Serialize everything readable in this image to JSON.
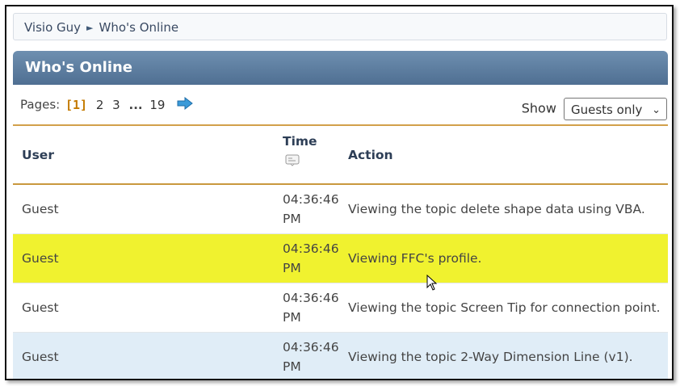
{
  "breadcrumb": {
    "items": [
      "Visio Guy",
      "Who's Online"
    ],
    "separator": "►"
  },
  "header": {
    "title": "Who's Online"
  },
  "pagination": {
    "label": "Pages:",
    "current": "[1]",
    "pages": [
      "2",
      "3"
    ],
    "ellipsis": "...",
    "last": "19"
  },
  "filter": {
    "label": "Show",
    "selected": "Guests only",
    "chevron": "⌄"
  },
  "table": {
    "columns": {
      "user": "User",
      "time": "Time",
      "action": "Action"
    },
    "rows": [
      {
        "user": "Guest",
        "time_line1": "04:36:46",
        "time_line2": "PM",
        "action": "Viewing the topic delete shape data using VBA."
      },
      {
        "user": "Guest",
        "time_line1": "04:36:46",
        "time_line2": "PM",
        "action": "Viewing FFC's profile."
      },
      {
        "user": "Guest",
        "time_line1": "04:36:46",
        "time_line2": "PM",
        "action": "Viewing the topic Screen Tip for connection point."
      },
      {
        "user": "Guest",
        "time_line1": "04:36:46",
        "time_line2": "PM",
        "action": "Viewing the topic 2-Way Dimension Line (v1)."
      }
    ]
  },
  "colors": {
    "header": "#5a7a9c",
    "highlight_row": "#f0f22f",
    "alt_row": "#e0edf7",
    "current_page": "#c47a00"
  }
}
